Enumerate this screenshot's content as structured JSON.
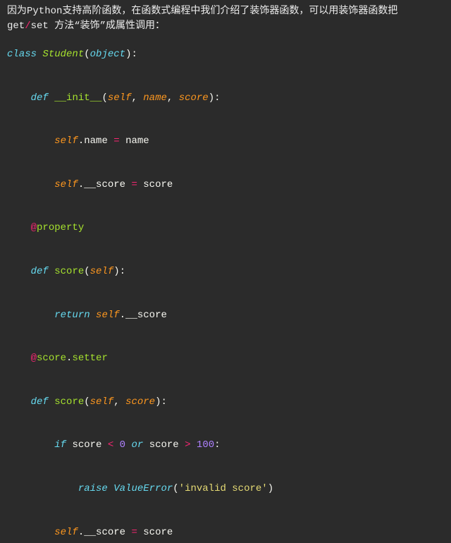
{
  "intro": {
    "p1a": "因为",
    "py": "Python",
    "p1b": "支持高阶函数，在函数式编程中我们介绍了装饰器函数，可以用装饰器函数把 ",
    "get": "get",
    "slash": "/",
    "set": "set",
    "p1c": " 方法“装饰”成属性调用："
  },
  "code": {
    "class_kw": "class",
    "class_name": "Student",
    "object": "object",
    "def_kw": "def",
    "init": "__init__",
    "self": "self",
    "name_param": "name",
    "score_param": "score",
    "dot": ".",
    "name_attr": "name",
    "eq": " = ",
    "name_rhs": "name",
    "uscore_attr": "__score",
    "score_rhs": "score",
    "property": "property",
    "score_fn": "score",
    "return_kw": "return",
    "setter": "setter",
    "if_kw": "if",
    "score_var": "score",
    "lt": " < ",
    "zero": "0",
    "or_kw": " or ",
    "gt": " > ",
    "hundred": "100",
    "raise_kw": "raise",
    "valueerror": "ValueError",
    "err_str": "'invalid score'"
  }
}
